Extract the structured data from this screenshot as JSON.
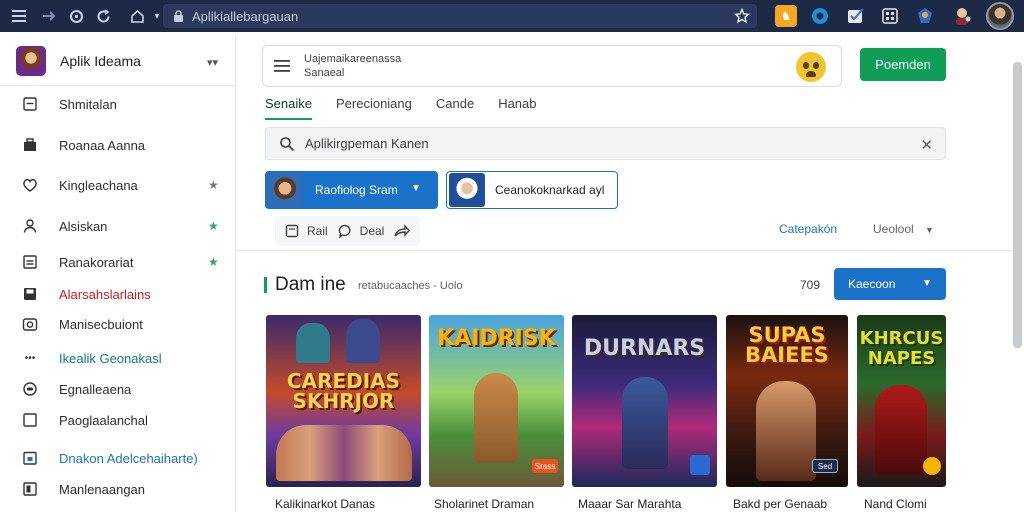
{
  "browser": {
    "url": "Aplikiallebargauan"
  },
  "sidebar": {
    "app_title": "Aplik Ideama",
    "items": [
      {
        "label": "Shmitalan",
        "icon": "tablet-icon"
      },
      {
        "label": "Roanaa Aanna",
        "icon": "suitcase-icon"
      },
      {
        "label": "Kingleachana",
        "icon": "heart-icon"
      },
      {
        "label": "Alsiskan",
        "icon": "user-icon"
      },
      {
        "label": "Ranakorariat",
        "icon": "inbox-icon"
      },
      {
        "label": "Alarsahslarlains",
        "icon": "save-icon"
      },
      {
        "label": "Manisecbuiont",
        "icon": "camera-icon"
      },
      {
        "label": "Ikealik Geonakasl",
        "icon": "dots-icon"
      },
      {
        "label": "Egnalleaena",
        "icon": "gamepad-icon"
      },
      {
        "label": "Paoglaalanchal",
        "icon": "square-icon"
      },
      {
        "label": "Dnakon Adelcehaiharte)",
        "icon": "calendar-icon"
      },
      {
        "label": "Manlenaangan",
        "icon": "panel-icon"
      }
    ],
    "colors": {
      "red_item": "#c5221f",
      "teal_item": "#137a7f",
      "blue_item": "#1a73c9",
      "star_green": "#34a853"
    }
  },
  "header": {
    "line1": "Uajemaikareenassa",
    "line2": "Sanaeal",
    "button": "Poemden"
  },
  "tabs": [
    "Senaike",
    "Perecioniang",
    "Cande",
    "Hanab"
  ],
  "search": {
    "value": "Aplikirgpeman Kanen"
  },
  "chips": {
    "primary": "Raofiolog Sram",
    "secondary": "Ceanokoknarkad ayl"
  },
  "actions": {
    "a1": "Rail",
    "a2": "Deal"
  },
  "toolbar": {
    "link": "Catepakón",
    "sort": "Ueolool"
  },
  "section": {
    "title": "Dam ine",
    "subtitle": "retabucaaches - Uolo",
    "count": "709",
    "button": "Kaecoon"
  },
  "games": [
    {
      "art_title": "CAREDIAS SKHRJOR",
      "name": "Kalikinarkot Danas",
      "badge": ""
    },
    {
      "art_title": "KAIDRISK",
      "name": "Sholarinet Draman",
      "badge": "Srass"
    },
    {
      "art_title": "DURNARS",
      "name": "Maaar Sar Marahta",
      "badge": ""
    },
    {
      "art_title": "SUPAS BAIEES",
      "name": "Bakd per Genaab",
      "badge": "Sed"
    },
    {
      "art_title": "KHRCUS NAPES",
      "name": "Nand Clomi",
      "badge": ""
    }
  ]
}
